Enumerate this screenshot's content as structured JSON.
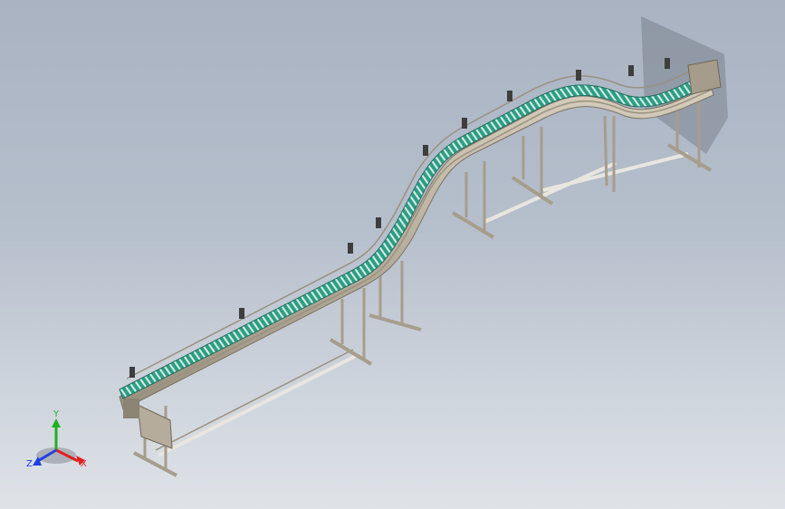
{
  "viewport": {
    "background_top": "#a9b3c2",
    "background_bottom": "#dfe3e8"
  },
  "model": {
    "belt_color": "#2f9e86",
    "frame_color": "#bdb3a3",
    "frame_shadow": "#8e8474"
  },
  "triad": {
    "x_label": "X",
    "y_label": "Y",
    "z_label": "Z",
    "x_color": "#e02020",
    "y_color": "#20b020",
    "z_color": "#2040e0"
  }
}
